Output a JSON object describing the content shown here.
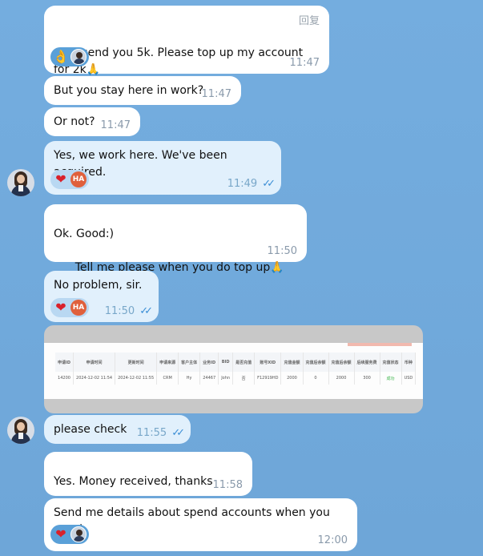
{
  "messages": {
    "m1": {
      "text": "I send you 5k. Please top up my account for 2k",
      "time": "11:47",
      "reply_label": "回复"
    },
    "m2": {
      "text": "But you stay here in work?",
      "time": "11:47"
    },
    "m3": {
      "text": "Or not?",
      "time": "11:47"
    },
    "m4": {
      "text": "Yes, we work here. We've been acquired.",
      "time": "11:49",
      "react_initials": "HA"
    },
    "m5": {
      "line1": "Ok. Good:)",
      "line2": "Tell me please when you do top up",
      "time": "11:50"
    },
    "m6": {
      "text": "No problem, sir.",
      "time": "11:50",
      "react_initials": "HA"
    },
    "m7": {
      "text": "please check",
      "time": "11:55"
    },
    "m8": {
      "text": "Yes. Money received, thanks",
      "time": "11:58"
    },
    "m9": {
      "text": "Send me details about spend accounts when you got ;)",
      "time": "12:00"
    }
  },
  "screenshot": {
    "headers": [
      "申请ID",
      "申请时间",
      "更新时间",
      "申请来源",
      "客户主体",
      "业务ID",
      "BID",
      "是否充值",
      "账号XID",
      "充值金额",
      "充值后余额",
      "充值后余额",
      "后续服务费",
      "充值状态",
      "币种"
    ],
    "row": [
      "14200",
      "2024-12-02 11:54",
      "2024-12-02 11:55",
      "CRM",
      "Hy",
      "24467",
      "John",
      "否",
      "F12919HD",
      "2000",
      "0",
      "2000",
      "300",
      "成功",
      "USD"
    ]
  },
  "colors": {
    "background": "#6fa8dc",
    "incoming_bubble": "#ffffff",
    "outgoing_bubble": "#e1f0fc",
    "read_checks": "#3d8fd6",
    "heart": "#d9212b",
    "initials_badge": "#e0603c"
  },
  "icons": {
    "ok_hand": "ok-hand-icon",
    "heart": "heart-icon",
    "prayer": "folded-hands-icon",
    "read": "double-check-icon"
  }
}
